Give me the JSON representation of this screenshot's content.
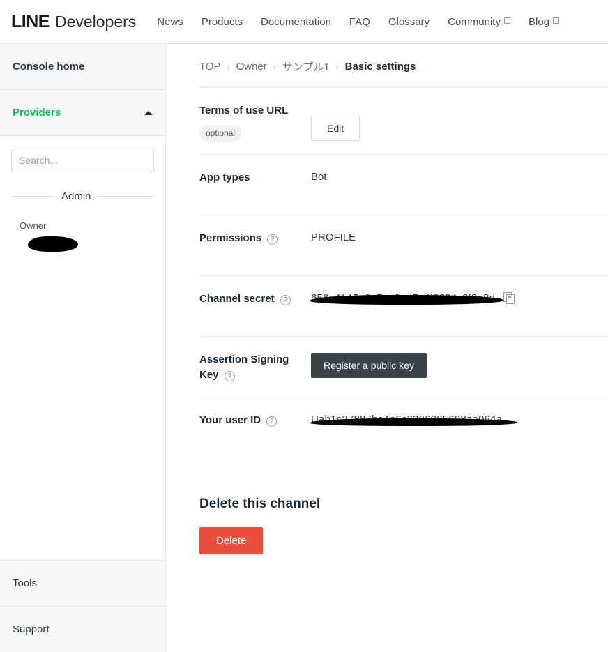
{
  "header": {
    "logo_line": "LINE",
    "logo_dev": "Developers",
    "nav": [
      {
        "label": "News",
        "external": false
      },
      {
        "label": "Products",
        "external": false
      },
      {
        "label": "Documentation",
        "external": false
      },
      {
        "label": "FAQ",
        "external": false
      },
      {
        "label": "Glossary",
        "external": false
      },
      {
        "label": "Community",
        "external": true
      },
      {
        "label": "Blog",
        "external": true
      }
    ]
  },
  "sidebar": {
    "console_home": "Console home",
    "providers": "Providers",
    "providers_color": "#06c755",
    "search_placeholder": "Search...",
    "search_value": "",
    "admin_divider_label": "Admin",
    "owner_label": "Owner",
    "owner_name_redacted": "",
    "bottom_items": [
      {
        "label": "Tools"
      },
      {
        "label": "Support"
      }
    ]
  },
  "breadcrumb": {
    "items": [
      {
        "label": "TOP",
        "current": false
      },
      {
        "label": "Owner",
        "current": false
      },
      {
        "label": "サンプル1",
        "current": false
      },
      {
        "label": "Basic settings",
        "current": true
      }
    ],
    "separator": "›"
  },
  "main": {
    "rows": {
      "terms_of_use": {
        "label": "Terms of use URL",
        "badge": "optional",
        "edit_button": "Edit"
      },
      "app_types": {
        "label": "App types",
        "value": "Bot"
      },
      "permissions": {
        "label": "Permissions",
        "help": "?",
        "value": "PROFILE"
      },
      "channel_secret": {
        "label": "Channel secret",
        "help": "?",
        "value": "656a4145e6a7ed8ad7a4f8884c3f8a8d",
        "copy_icon": "copy-icon"
      },
      "assertion_signing_key": {
        "label": "Assertion Signing Key",
        "help": "?",
        "button": "Register a public key"
      },
      "your_user_id": {
        "label": "Your user ID",
        "help": "?",
        "value": "Uab1c27887ba4e6c3396985698aa064a"
      }
    },
    "delete_section": {
      "title": "Delete this channel",
      "button": "Delete",
      "button_color": "#ea4e3d"
    }
  }
}
